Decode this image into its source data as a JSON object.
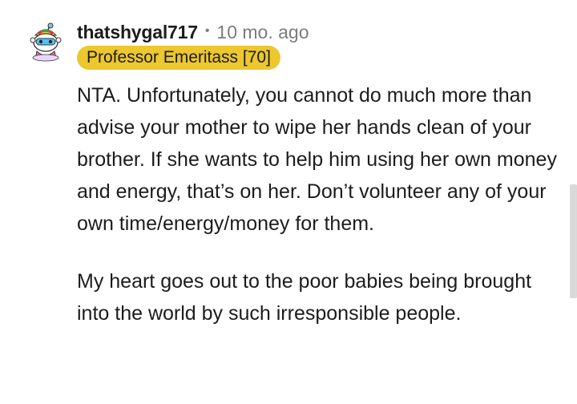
{
  "comment": {
    "username": "thatshygal717",
    "separator": "•",
    "age": "10 mo. ago",
    "flair": "Professor Emeritass [70]",
    "flair_color": "#ecc72e",
    "avatar_icon": "snoo-avatar-icon",
    "paragraphs": [
      "NTA. Unfortunately, you cannot do much more than advise your mother to wipe her hands clean of your brother. If she wants to help him using her own money and energy, that’s on her. Don’t volunteer any of your own time/energy/money for them.",
      "My heart goes out to the poor babies being brought into the world by such irresponsible people."
    ]
  }
}
